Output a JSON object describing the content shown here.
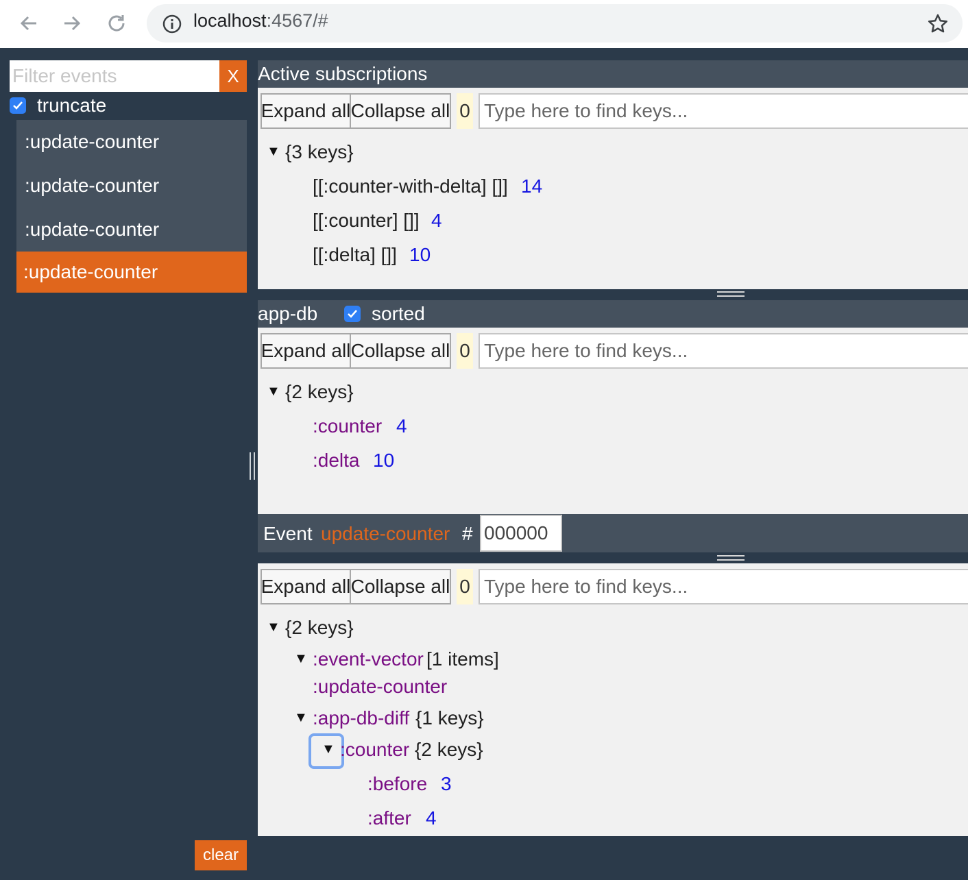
{
  "browser": {
    "back_icon": "arrow-left-icon",
    "forward_icon": "arrow-right-icon",
    "reload_icon": "reload-icon",
    "info_icon": "info-icon",
    "bookmark_icon": "star-icon",
    "url_host": "localhost",
    "url_rest": ":4567/#"
  },
  "sidebar": {
    "filter_placeholder": "Filter events",
    "filter_clear_label": "X",
    "truncate_label": "truncate",
    "events": [
      ":update-counter",
      ":update-counter",
      ":update-counter",
      ":update-counter"
    ],
    "selected_index": 3,
    "clear_label": "clear"
  },
  "subscriptions": {
    "title": "Active subscriptions",
    "expand_label": "Expand all",
    "collapse_label": "Collapse all",
    "count": "0",
    "search_placeholder": "Type here to find keys...",
    "root": "{3 keys}",
    "items": [
      {
        "key": "[[:counter-with-delta] []]",
        "value": "14"
      },
      {
        "key": "[[:counter] []]",
        "value": "4"
      },
      {
        "key": "[[:delta] []]",
        "value": "10"
      }
    ]
  },
  "appdb": {
    "title": "app-db",
    "sorted_label": "sorted",
    "expand_label": "Expand all",
    "collapse_label": "Collapse all",
    "count": "0",
    "search_placeholder": "Type here to find keys...",
    "root": "{2 keys}",
    "items": [
      {
        "key": ":counter",
        "value": "4"
      },
      {
        "key": ":delta",
        "value": "10"
      }
    ]
  },
  "event": {
    "label": "Event",
    "name": "update-counter",
    "hash": "#",
    "number": "000000",
    "expand_label": "Expand all",
    "collapse_label": "Collapse all",
    "count": "0",
    "search_placeholder": "Type here to find keys...",
    "root": "{2 keys}",
    "event_vector_key": ":event-vector",
    "event_vector_meta": "[1 items]",
    "event_vector_item": ":update-counter",
    "diff_key": ":app-db-diff",
    "diff_meta": "{1 keys}",
    "counter_key": ":counter",
    "counter_meta": "{2 keys}",
    "before_key": ":before",
    "before_value": "3",
    "after_key": ":after",
    "after_value": "4"
  }
}
